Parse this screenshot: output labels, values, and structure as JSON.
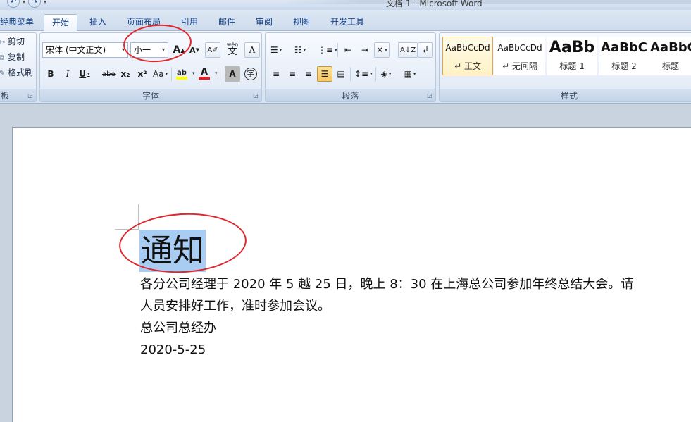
{
  "window": {
    "title": "文档 1 - Microsoft Word"
  },
  "qat": {
    "undo_icon": "undo-icon",
    "redo_icon": "redo-icon"
  },
  "tabs": [
    {
      "label": "经典菜单",
      "active": false
    },
    {
      "label": "开始",
      "active": true
    },
    {
      "label": "插入",
      "active": false
    },
    {
      "label": "页面布局",
      "active": false
    },
    {
      "label": "引用",
      "active": false
    },
    {
      "label": "邮件",
      "active": false
    },
    {
      "label": "审阅",
      "active": false
    },
    {
      "label": "视图",
      "active": false
    },
    {
      "label": "开发工具",
      "active": false
    }
  ],
  "clipboard": {
    "cut": "剪切",
    "copy": "复制",
    "format_painter": "格式刷",
    "label": "板"
  },
  "font": {
    "label": "字体",
    "name": "宋体 (中文正文)",
    "size": "小一",
    "bold": "B",
    "italic": "I",
    "underline": "U",
    "strike": "abe",
    "subscript": "x₂",
    "superscript": "x²",
    "change_case": "Aa",
    "grow": "A",
    "shrink": "A",
    "font_color": "A",
    "char_shading": "A",
    "char_border": "A",
    "phonetic": "wén",
    "phonetic_char": "文",
    "enclose": "字",
    "highlight": "ab"
  },
  "paragraph": {
    "label": "段落"
  },
  "styles": {
    "label": "样式",
    "items": [
      {
        "sample": "AaBbCcDd",
        "name": "↵ 正文",
        "selected": true
      },
      {
        "sample": "AaBbCcDd",
        "name": "↵ 无间隔",
        "selected": false
      },
      {
        "sample": "AaBb",
        "name": "标题 1",
        "selected": false
      },
      {
        "sample": "AaBbC",
        "name": "标题 2",
        "selected": false
      },
      {
        "sample": "AaBbC",
        "name": "标题",
        "selected": false
      }
    ]
  },
  "colors": {
    "annotation": "#e0262d",
    "selection": "#a9cdf2",
    "font_color_bar": "#e02020",
    "highlight_bar": "#ffff00"
  },
  "document": {
    "title": "通知",
    "lines": [
      "各分公司经理于 2020 年 5 越 25 日，晚上 8：30 在上海总公司参加年终总结大会。请",
      "人员安排好工作，准时参加会议。",
      "总公司总经办",
      "2020-5-25"
    ]
  }
}
